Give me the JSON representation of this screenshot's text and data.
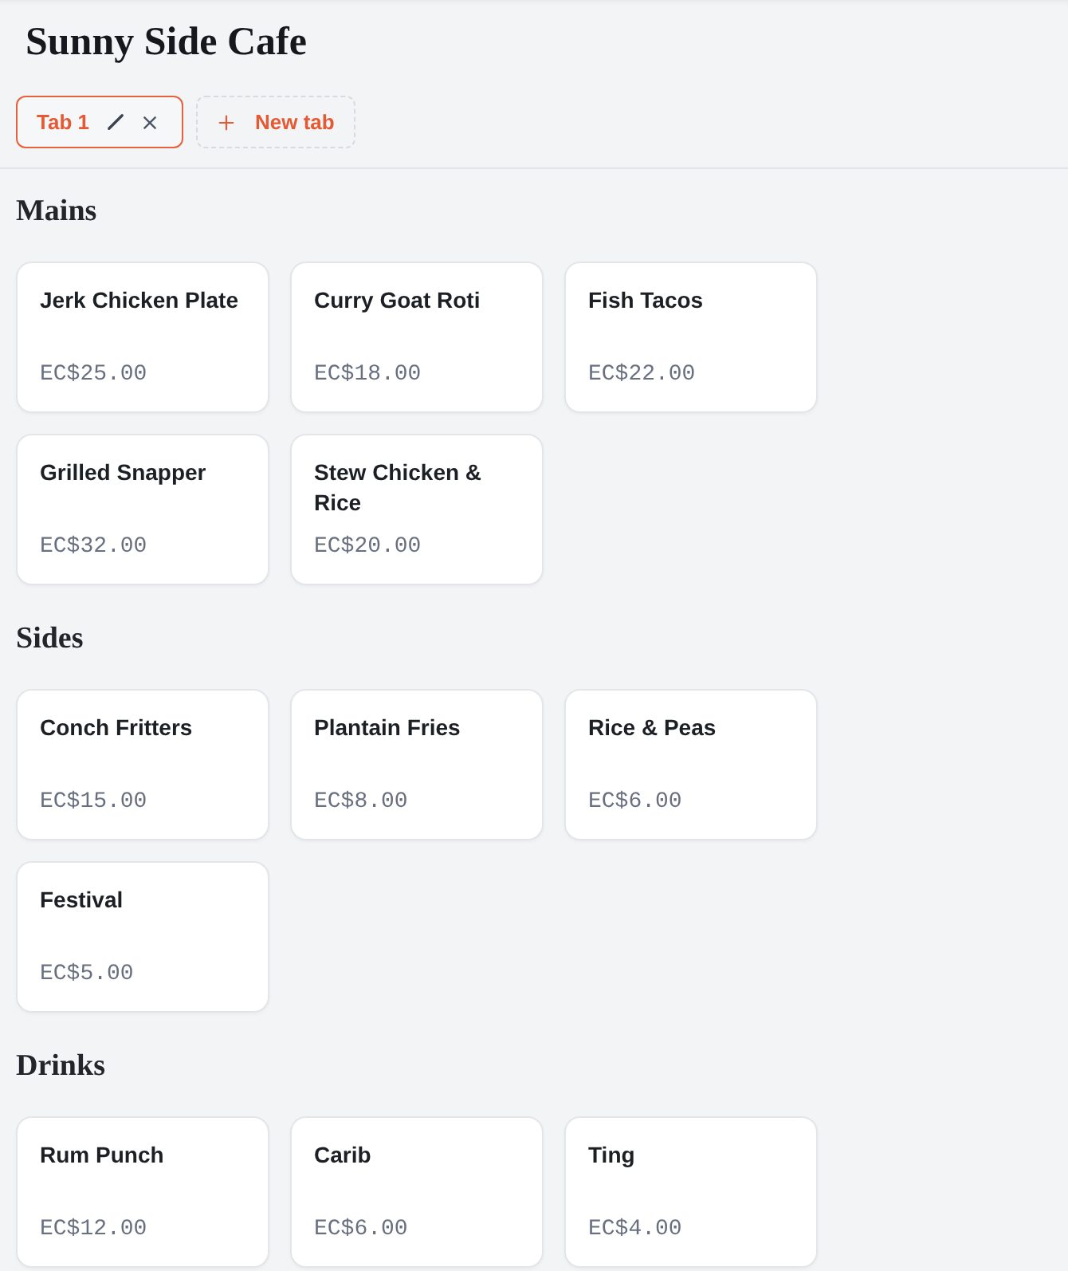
{
  "header": {
    "title": "Sunny Side Cafe"
  },
  "tabs": [
    {
      "label": "Tab 1",
      "selected": true
    }
  ],
  "new_tab_button": {
    "label": "New tab"
  },
  "sections": [
    {
      "title": "Mains",
      "items": [
        {
          "name": "Jerk Chicken Plate",
          "price": "EC$25.00"
        },
        {
          "name": "Curry Goat Roti",
          "price": "EC$18.00"
        },
        {
          "name": "Fish Tacos",
          "price": "EC$22.00"
        },
        {
          "name": "Grilled Snapper",
          "price": "EC$32.00"
        },
        {
          "name": "Stew Chicken & Rice",
          "price": "EC$20.00"
        }
      ]
    },
    {
      "title": "Sides",
      "items": [
        {
          "name": "Conch Fritters",
          "price": "EC$15.00"
        },
        {
          "name": "Plantain Fries",
          "price": "EC$8.00"
        },
        {
          "name": "Rice & Peas",
          "price": "EC$6.00"
        },
        {
          "name": "Festival",
          "price": "EC$5.00"
        }
      ]
    },
    {
      "title": "Drinks",
      "items": [
        {
          "name": "Rum Punch",
          "price": "EC$12.00"
        },
        {
          "name": "Carib",
          "price": "EC$6.00"
        },
        {
          "name": "Ting",
          "price": "EC$4.00"
        }
      ]
    }
  ]
}
